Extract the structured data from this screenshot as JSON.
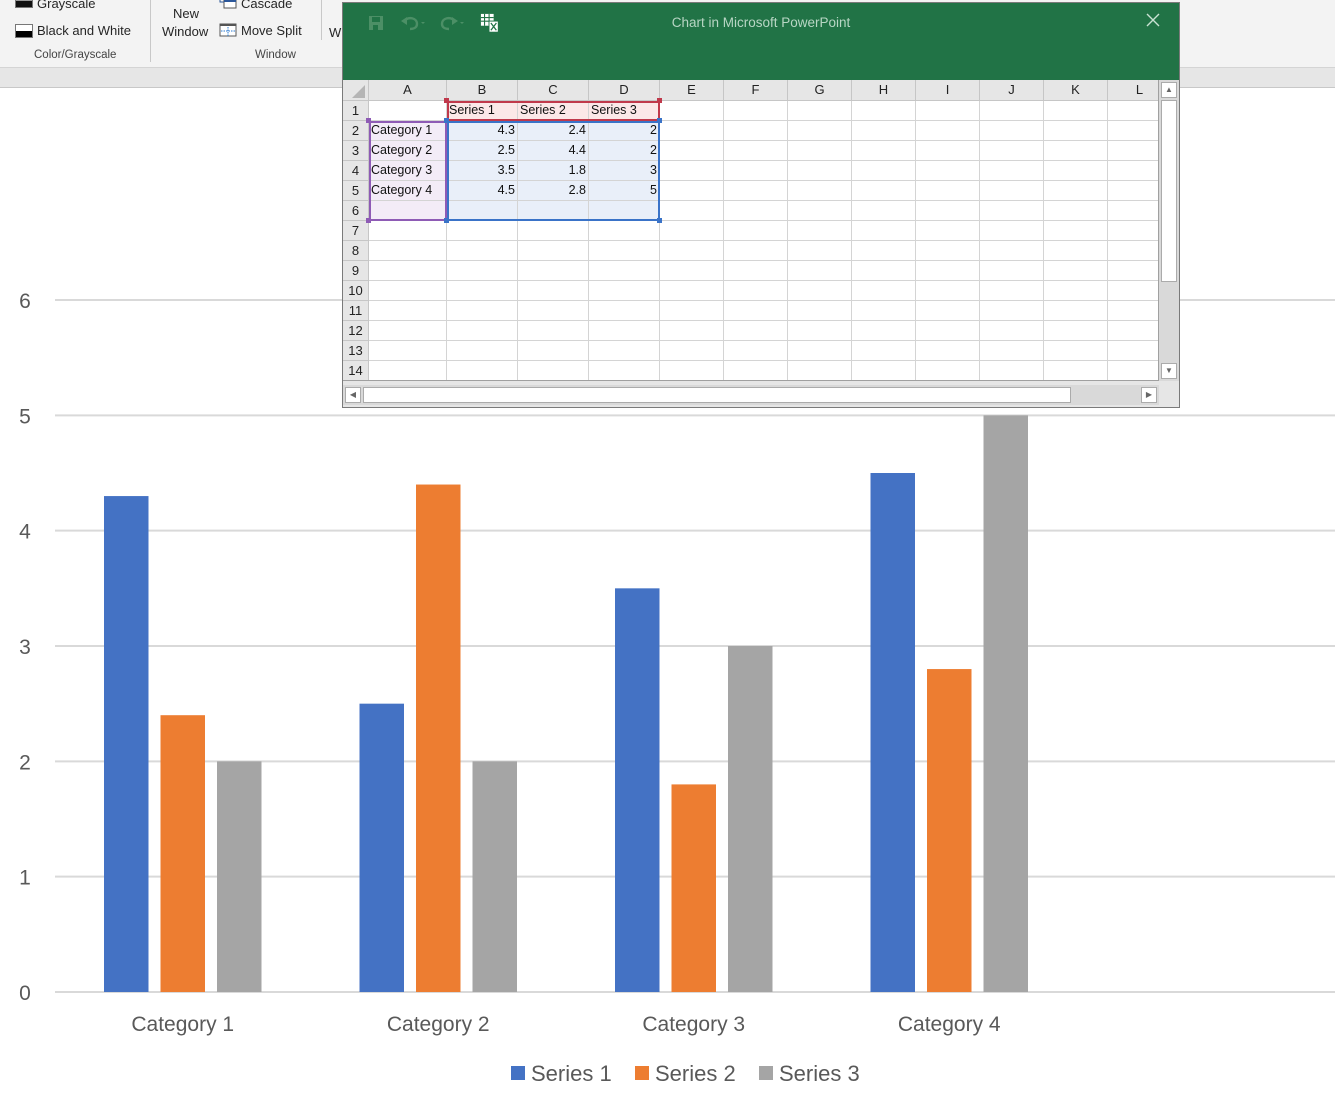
{
  "ribbon": {
    "color_group": {
      "grayscale_label": "Grayscale",
      "black_white_label": "Black and White",
      "group_label": "Color/Grayscale"
    },
    "window_group": {
      "new_window_line1": "New",
      "new_window_line2": "Window",
      "cascade_label": "Cascade",
      "move_split_label": "Move Split",
      "group_label": "Window",
      "truncated_next": "W"
    }
  },
  "dialog": {
    "title": "Chart in Microsoft PowerPoint",
    "close_icon": "close-icon",
    "quick_access": [
      "save-icon",
      "undo-icon",
      "redo-icon",
      "edit-data-in-excel-icon"
    ],
    "columns": [
      "A",
      "B",
      "C",
      "D",
      "E",
      "F",
      "G",
      "H",
      "I",
      "J",
      "K",
      "L"
    ],
    "rows": [
      "1",
      "2",
      "3",
      "4",
      "5",
      "6",
      "7",
      "8",
      "9",
      "10",
      "11",
      "12",
      "13",
      "14"
    ],
    "cells": [
      [
        "",
        "Series 1",
        "Series 2",
        "Series 3"
      ],
      [
        "Category 1",
        "4.3",
        "2.4",
        "2"
      ],
      [
        "Category 2",
        "2.5",
        "4.4",
        "2"
      ],
      [
        "Category 3",
        "3.5",
        "1.8",
        "3"
      ],
      [
        "Category 4",
        "4.5",
        "2.8",
        "5"
      ]
    ],
    "colors": {
      "title_bar": "#217346",
      "series_range": "#c0394b",
      "category_range": "#8e5bb5",
      "values_range": "#3a73c8"
    }
  },
  "chart_data": {
    "type": "bar",
    "title": "",
    "xlabel": "",
    "ylabel": "",
    "categories": [
      "Category 1",
      "Category 2",
      "Category 3",
      "Category 4"
    ],
    "series": [
      {
        "name": "Series 1",
        "color": "#4472c4",
        "values": [
          4.3,
          2.5,
          3.5,
          4.5
        ]
      },
      {
        "name": "Series 2",
        "color": "#ed7d31",
        "values": [
          2.4,
          4.4,
          1.8,
          2.8
        ]
      },
      {
        "name": "Series 3",
        "color": "#a5a5a5",
        "values": [
          2,
          2,
          3,
          5
        ]
      }
    ],
    "ylim": [
      0,
      6
    ],
    "yticks": [
      "0",
      "1",
      "2",
      "3",
      "4",
      "5",
      "6"
    ],
    "grid": true,
    "legend": "bottom",
    "gridline_color": "#d9d9d9",
    "text_color": "#595959"
  }
}
